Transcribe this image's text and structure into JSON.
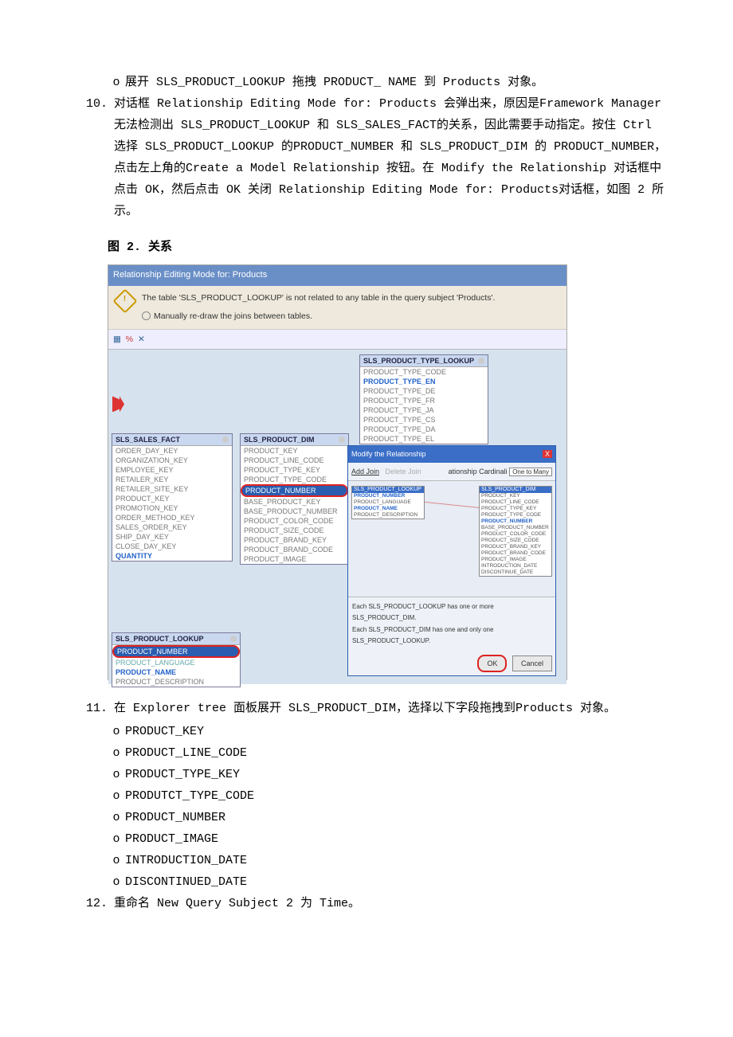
{
  "bullet_top": {
    "marker": "o",
    "text": "展开 SLS_PRODUCT_LOOKUP 拖拽 PRODUCT_ NAME 到 Products 对象。"
  },
  "step10": {
    "num": "10.",
    "text": "对话框 Relationship Editing Mode for: Products 会弹出来，原因是Framework Manager 无法检测出 SLS_PRODUCT_LOOKUP 和 SLS_SALES_FACT的关系，因此需要手动指定。按住 Ctrl 选择 SLS_PRODUCT_LOOKUP 的PRODUCT_NUMBER 和 SLS_PRODUCT_DIM 的 PRODUCT_NUMBER，点击左上角的Create a Model Relationship 按钮。在 Modify the Relationship 对话框中点击 OK，然后点击 OK 关闭 Relationship Editing Mode for: Products对话框，如图 2 所示。"
  },
  "fig2": "图 2. 关系",
  "screenshot": {
    "title": "Relationship Editing Mode for: Products",
    "warn": "The table 'SLS_PRODUCT_LOOKUP' is not related to any table in the query subject 'Products'.",
    "radio": "Manually re-draw the joins between tables.",
    "toolbar_x": "✕",
    "tables": {
      "fact": {
        "title": "SLS_SALES_FACT",
        "rows": [
          "ORDER_DAY_KEY",
          "ORGANIZATION_KEY",
          "EMPLOYEE_KEY",
          "RETAILER_KEY",
          "RETAILER_SITE_KEY",
          "PRODUCT_KEY",
          "PROMOTION_KEY",
          "ORDER_METHOD_KEY",
          "SALES_ORDER_KEY",
          "SHIP_DAY_KEY",
          "CLOSE_DAY_KEY"
        ],
        "bold": "QUANTITY"
      },
      "dim": {
        "title": "SLS_PRODUCT_DIM",
        "rows": [
          "PRODUCT_KEY",
          "PRODUCT_LINE_CODE",
          "PRODUCT_TYPE_KEY",
          "PRODUCT_TYPE_CODE",
          "PRODUCT_NUMBER",
          "BASE_PRODUCT_KEY",
          "BASE_PRODUCT_NUMBER",
          "PRODUCT_COLOR_CODE",
          "PRODUCT_SIZE_CODE",
          "PRODUCT_BRAND_KEY",
          "PRODUCT_BRAND_CODE",
          "PRODUCT_IMAGE"
        ]
      },
      "typelk": {
        "title": "SLS_PRODUCT_TYPE_LOOKUP",
        "rows": [
          "PRODUCT_TYPE_CODE"
        ],
        "bold": "PRODUCT_TYPE_EN",
        "more": [
          "PRODUCT_TYPE_DE",
          "PRODUCT_TYPE_FR",
          "PRODUCT_TYPE_JA",
          "PRODUCT_TYPE_CS",
          "PRODUCT_TYPE_DA",
          "PRODUCT_TYPE_EL"
        ]
      },
      "lookup": {
        "title": "SLS_PRODUCT_LOOKUP",
        "sel": "PRODUCT_NUMBER",
        "rows": [
          "PRODUCT_LANGUAGE"
        ],
        "bold": "PRODUCT_NAME",
        "more": [
          "PRODUCT_DESCRIPTION"
        ]
      }
    },
    "dialog": {
      "title": "Modify the Relationship",
      "add_join": "Add Join",
      "del_join": "Delete Join",
      "card_lbl": "ationship Cardinali",
      "card_val": "One to Many",
      "left": {
        "title": "SLS_PRODUCT_LOOKUP",
        "rows": [
          "PRODUCT_NUMBER",
          "PRODUCT_LANGUAGE",
          "PRODUCT_NAME",
          "PRODUCT_DESCRIPTION"
        ]
      },
      "right": {
        "title": "SLS_PRODUCT_DIM",
        "rows": [
          "PRODUCT_KEY",
          "PRODUCT_LINE_CODE",
          "PRODUCT_TYPE_KEY",
          "PRODUCT_TYPE_CODE",
          "PRODUCT_NUMBER",
          "BASE_PRODUCT_NUMBER",
          "PRODUCT_COLOR_CODE",
          "PRODUCT_SIZE_CODE",
          "PRODUCT_BRAND_KEY",
          "PRODUCT_BRAND_CODE",
          "PRODUCT_IMAGE",
          "INTRODUCTION_DATE",
          "DISCONTINUE_DATE"
        ]
      },
      "foot1": "Each SLS_PRODUCT_LOOKUP has one or more SLS_PRODUCT_DIM.",
      "foot2": "Each SLS_PRODUCT_DIM has one and only one SLS_PRODUCT_LOOKUP.",
      "ok": "OK",
      "cancel": "Cancel"
    }
  },
  "step11": {
    "num": "11.",
    "text": "在 Explorer tree 面板展开 SLS_PRODUCT_DIM，选择以下字段拖拽到Products 对象。",
    "items": [
      "PRODUCT_KEY",
      "PRODUCT_LINE_CODE",
      "PRODUCT_TYPE_KEY",
      "PRODUTCT_TYPE_CODE",
      "PRODUCT_NUMBER",
      "PRODUCT_IMAGE",
      "INTRODUCTION_DATE",
      "DISCONTINUED_DATE"
    ],
    "marker": "o"
  },
  "step12": {
    "num": "12.",
    "text": "重命名 New Query Subject 2 为 Time。"
  }
}
